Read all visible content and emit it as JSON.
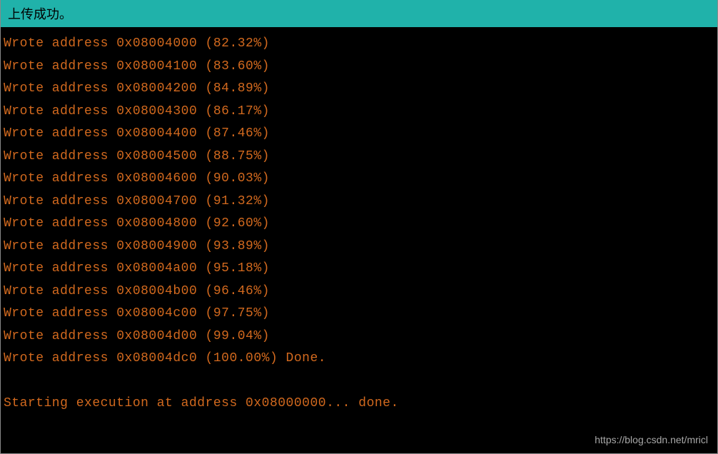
{
  "status_bar": {
    "message": "上传成功。"
  },
  "terminal": {
    "lines": [
      "Wrote address 0x08004000 (82.32%)",
      "Wrote address 0x08004100 (83.60%)",
      "Wrote address 0x08004200 (84.89%)",
      "Wrote address 0x08004300 (86.17%)",
      "Wrote address 0x08004400 (87.46%)",
      "Wrote address 0x08004500 (88.75%)",
      "Wrote address 0x08004600 (90.03%)",
      "Wrote address 0x08004700 (91.32%)",
      "Wrote address 0x08004800 (92.60%)",
      "Wrote address 0x08004900 (93.89%)",
      "Wrote address 0x08004a00 (95.18%)",
      "Wrote address 0x08004b00 (96.46%)",
      "Wrote address 0x08004c00 (97.75%)",
      "Wrote address 0x08004d00 (99.04%)",
      "Wrote address 0x08004dc0 (100.00%) Done.",
      "",
      "Starting execution at address 0x08000000... done."
    ]
  },
  "watermark": {
    "text": "https://blog.csdn.net/mricl"
  }
}
